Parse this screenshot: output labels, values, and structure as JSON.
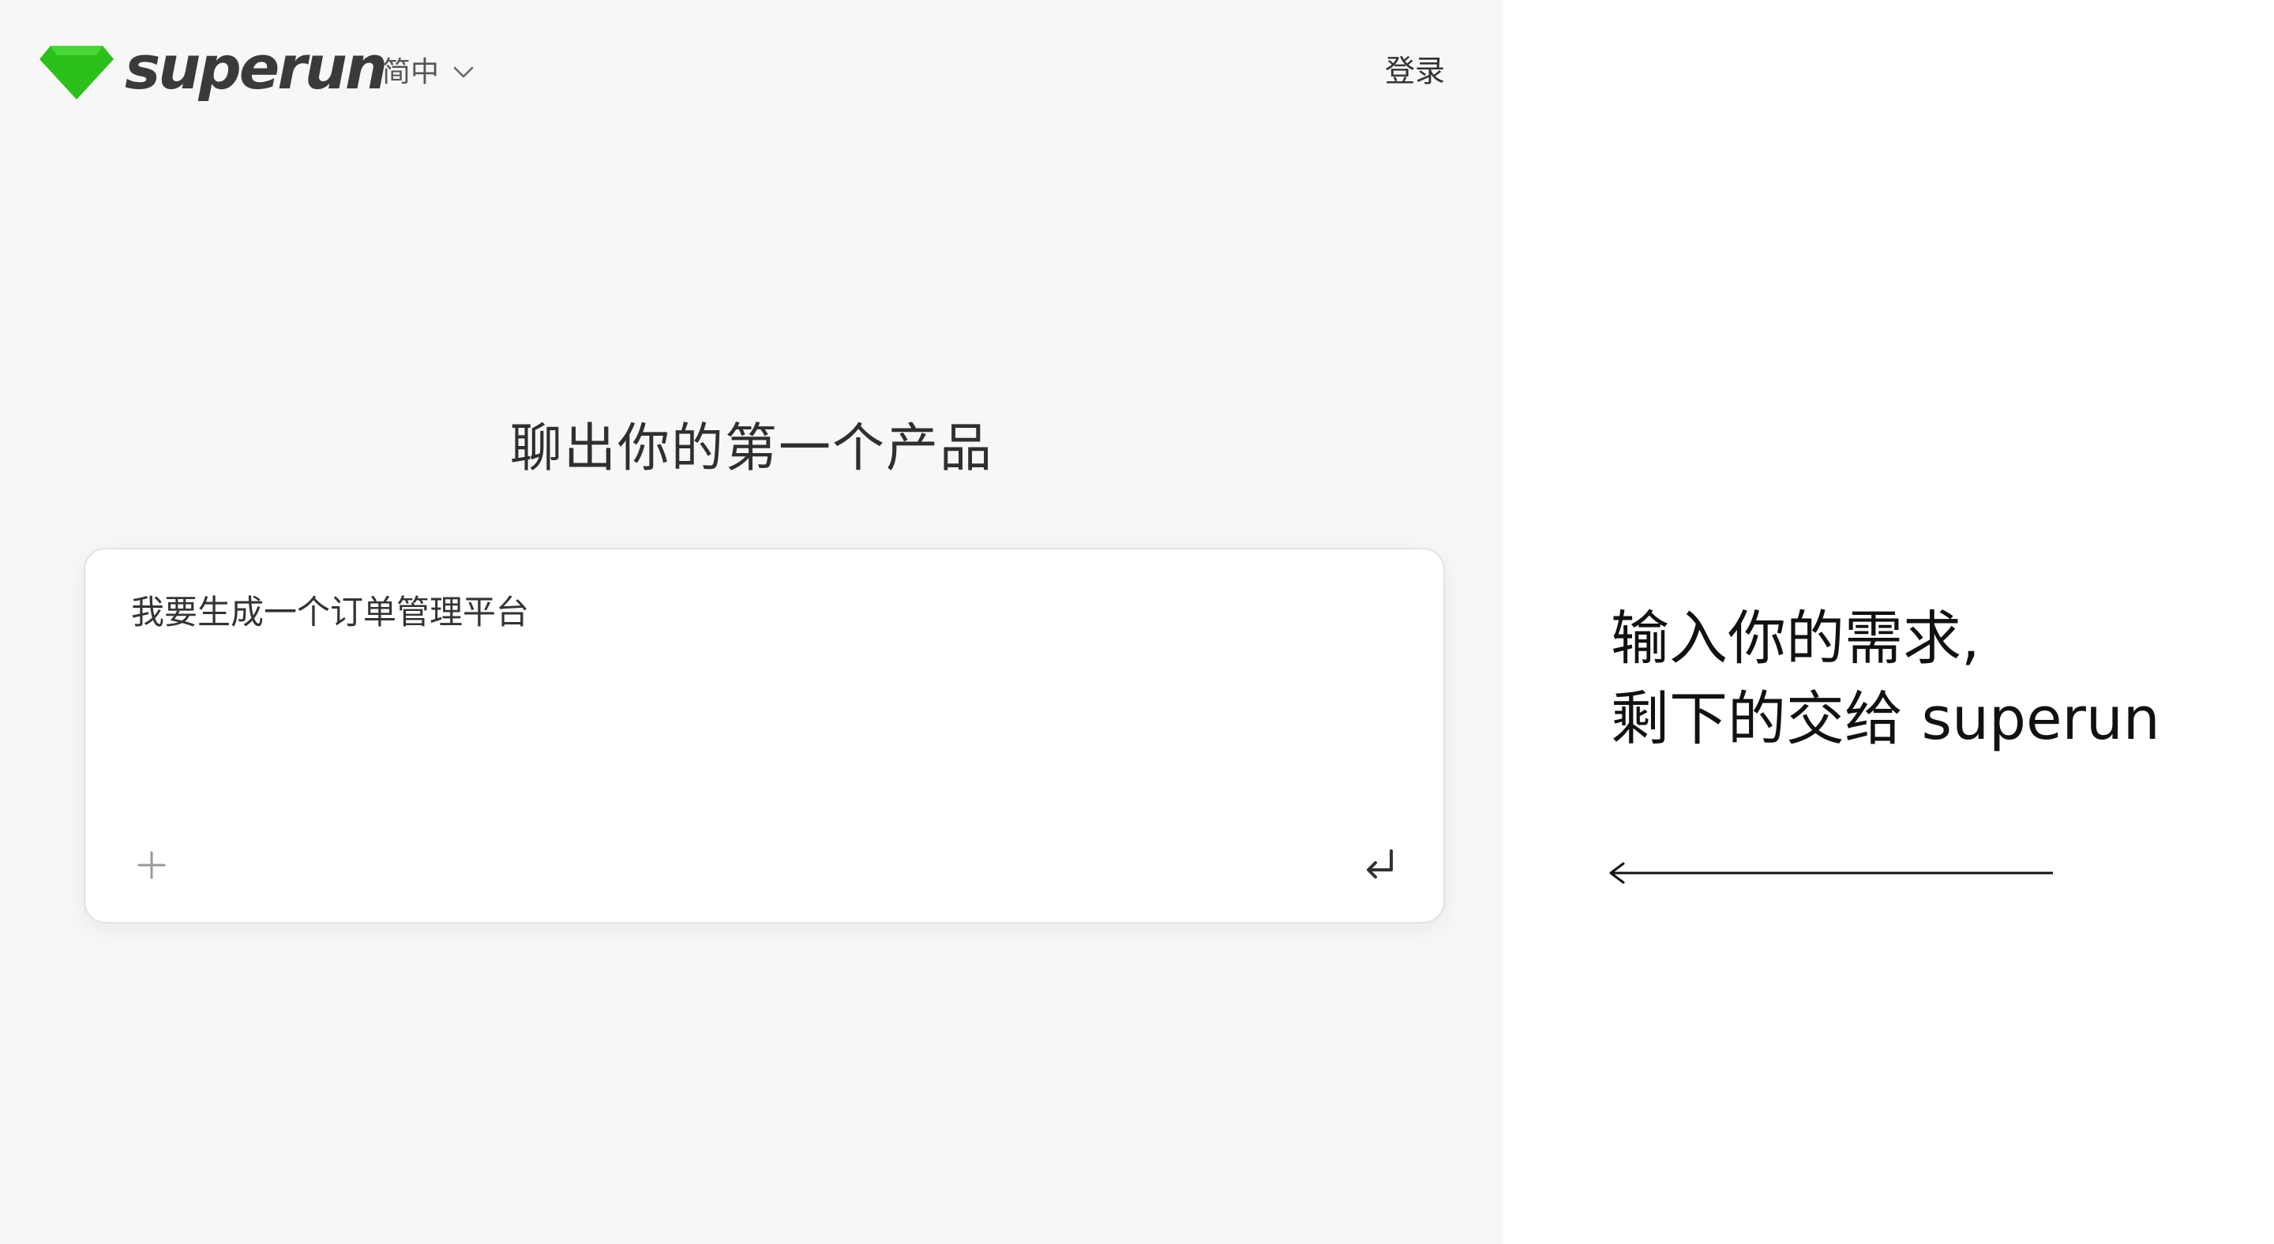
{
  "app": {
    "logo_text": "superun",
    "brand_color": "#2cc01a",
    "language": {
      "selected": "简中",
      "icon": "chevron-down-icon"
    },
    "login_label": "登录"
  },
  "hero": {
    "title": "聊出你的第一个产品"
  },
  "prompt": {
    "value": "我要生成一个订单管理平台",
    "attach_icon": "plus-icon",
    "submit_icon": "enter-icon"
  },
  "annotation": {
    "line1": "输入你的需求,",
    "line2": "剩下的交给 superun",
    "arrow_icon": "left-arrow-icon"
  }
}
